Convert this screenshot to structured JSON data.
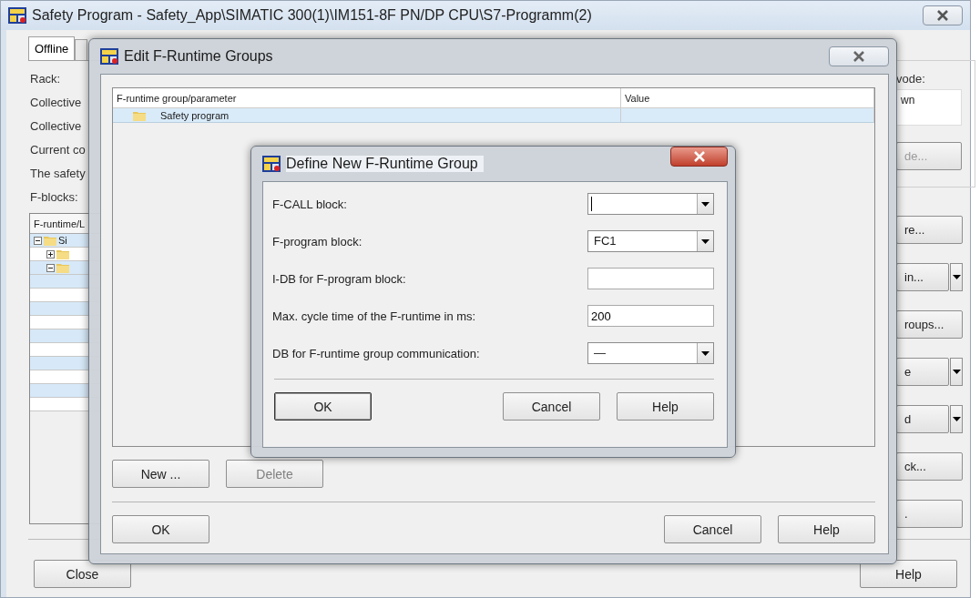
{
  "window": {
    "title": "Safety Program - Safety_App\\SIMATIC 300(1)\\IM151-8F PN/DP CPU\\S7-Programm(2)"
  },
  "tabs": [
    {
      "label": "Offline",
      "selected": true
    },
    {
      "selected": false
    }
  ],
  "left_labels": [
    "Rack:",
    "Collective",
    "Collective",
    "Current co",
    "The safety",
    "F-blocks:"
  ],
  "tree": {
    "header": "F-runtime/L",
    "items": [
      {
        "label": "Si",
        "expanded": true,
        "children": [
          {
            "expanded": false
          },
          {
            "expanded": true
          }
        ]
      }
    ]
  },
  "mode_group": {
    "label": "vode:",
    "value": "wn",
    "button": {
      "label": "de...",
      "disabled": true
    }
  },
  "side_buttons": [
    {
      "label": "re...",
      "kind": "plain"
    },
    {
      "label": "in...",
      "kind": "split"
    },
    {
      "label": "roups...",
      "kind": "plain"
    },
    {
      "label": "e",
      "kind": "split"
    },
    {
      "label": "d",
      "kind": "split"
    },
    {
      "label": "ck...",
      "kind": "plain"
    },
    {
      "label": ".",
      "kind": "plain"
    }
  ],
  "bottom_buttons": [
    "Close",
    "Help"
  ],
  "edit_dialog": {
    "title": "Edit F-Runtime Groups",
    "columns": [
      "F-runtime group/parameter",
      "Value"
    ],
    "rows": [
      {
        "name": "Safety program",
        "selected": true
      }
    ],
    "buttons": [
      {
        "label": "New ...",
        "disabled": false
      },
      {
        "label": "Delete",
        "disabled": true
      }
    ],
    "footer": [
      "OK",
      "Cancel",
      "Help"
    ]
  },
  "define_dialog": {
    "title": "Define New F-Runtime Group",
    "fields": [
      {
        "label": "F-CALL block:",
        "kind": "combo",
        "focused": true
      },
      {
        "label": "F-program block:",
        "kind": "combo",
        "value": "FC1",
        "focused": false
      },
      {
        "label": "I-DB for F-program block:",
        "kind": "text"
      },
      {
        "label": "Max. cycle time of the F-runtime in ms:",
        "kind": "text",
        "value": "200"
      },
      {
        "label": "DB for F-runtime group communication:",
        "kind": "combo",
        "value": "—",
        "focused": false
      }
    ],
    "buttons": [
      {
        "label": "OK",
        "default": true
      },
      {
        "label": "Cancel",
        "default": false
      },
      {
        "label": "Help",
        "default": false
      }
    ]
  }
}
